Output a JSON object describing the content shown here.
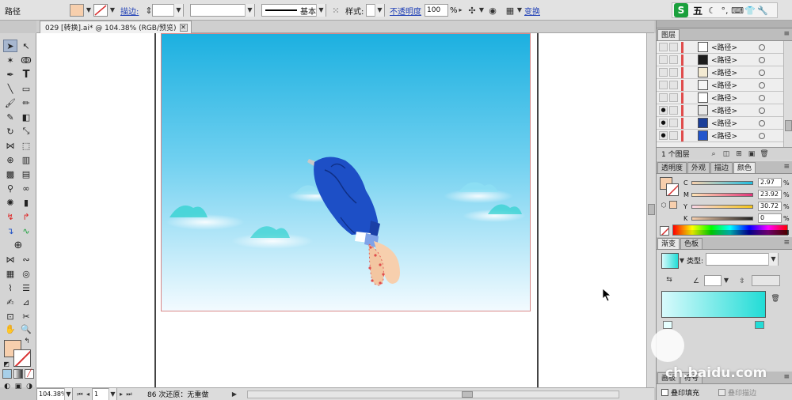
{
  "control_bar": {
    "object_type": "路径",
    "stroke_label": "描边:",
    "brush_style": "基本",
    "style_label": "样式:",
    "opacity_label": "不透明度",
    "opacity_value": "100",
    "opacity_unit": "%",
    "transform_label": "变换",
    "fill_color": "#f7cfad"
  },
  "doc_tab": {
    "title": "029 [转换].ai* @ 104.38% (RGB/预览)"
  },
  "status": {
    "zoom": "104.38%",
    "page": "1",
    "info": "86 次还原：无重做"
  },
  "layers_panel": {
    "title": "图层",
    "count_label": "1 个图层",
    "rows": [
      {
        "name": "<路径>",
        "thumb": "#ffffff",
        "visible": false
      },
      {
        "name": "<路径>",
        "thumb": "#1c1c1c",
        "visible": false
      },
      {
        "name": "<路径>",
        "thumb": "#f3ead2",
        "visible": false
      },
      {
        "name": "<路径>",
        "thumb": "#f6f6f6",
        "visible": false
      },
      {
        "name": "<路径>",
        "thumb": "#ffffff",
        "visible": false
      },
      {
        "name": "<路径>",
        "thumb": "#e8e8e8",
        "visible": true
      },
      {
        "name": "<路径>",
        "thumb": "#1b3f9a",
        "visible": true
      },
      {
        "name": "<路径>",
        "thumb": "#2255cc",
        "visible": true
      }
    ]
  },
  "color_panel": {
    "tabs": [
      "透明度",
      "外观",
      "描边",
      "颜色"
    ],
    "channels": [
      {
        "label": "C",
        "value": "2.97"
      },
      {
        "label": "M",
        "value": "23.92"
      },
      {
        "label": "Y",
        "value": "30.72"
      },
      {
        "label": "K",
        "value": "0"
      }
    ],
    "unit": "%"
  },
  "gradient_panel": {
    "tabs": [
      "渐变",
      "色板"
    ],
    "type_label": "类型:",
    "start_color": "#d8fafc",
    "end_color": "#22dcd6"
  },
  "bottom_panel": {
    "tabs": [
      "画板",
      "符号"
    ],
    "overprint_fill": "叠印填充",
    "overprint_stroke": "叠印描边"
  },
  "ime_bar": {
    "logo": "S",
    "mode": "五"
  },
  "watermark": {
    "text": "ch.baidu.com"
  },
  "colors": {
    "sky_top": "#1eb2e0",
    "sky_bottom": "#f2fbff",
    "figure_blue": "#1d4fc6",
    "skin": "#f7cfad",
    "accent_red": "#e04c4c"
  }
}
